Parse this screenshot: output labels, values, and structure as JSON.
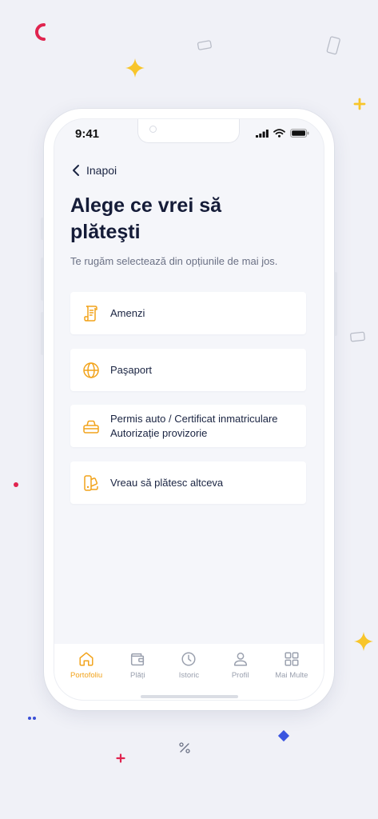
{
  "colors": {
    "accent": "#f2a31b",
    "title": "#151c38",
    "text": "#1a2442",
    "muted": "#6b7185",
    "tab_inactive": "#9aa0ae",
    "page_bg": "#f0f1f7"
  },
  "status_bar": {
    "time": "9:41"
  },
  "header": {
    "back_label": "Inapoi"
  },
  "main": {
    "title": "Alege ce vrei să plăteşti",
    "subtitle": "Te rugăm selectează din opțiunile de mai jos."
  },
  "options": [
    {
      "icon": "receipt-icon",
      "lines": [
        "Amenzi"
      ]
    },
    {
      "icon": "globe-icon",
      "lines": [
        "Paşaport"
      ]
    },
    {
      "icon": "car-icon",
      "lines": [
        "Permis auto / Certificat inmatriculare",
        "Autorizație provizorie"
      ]
    },
    {
      "icon": "palette-icon",
      "lines": [
        "Vreau să plătesc altceva"
      ]
    }
  ],
  "tabbar": [
    {
      "label": "Portofoliu",
      "icon": "home-icon",
      "active": true
    },
    {
      "label": "Plăți",
      "icon": "wallet-icon",
      "active": false
    },
    {
      "label": "Istoric",
      "icon": "clock-icon",
      "active": false
    },
    {
      "label": "Profil",
      "icon": "user-icon",
      "active": false
    },
    {
      "label": "Mai Multe",
      "icon": "grid-icon",
      "active": false
    }
  ]
}
